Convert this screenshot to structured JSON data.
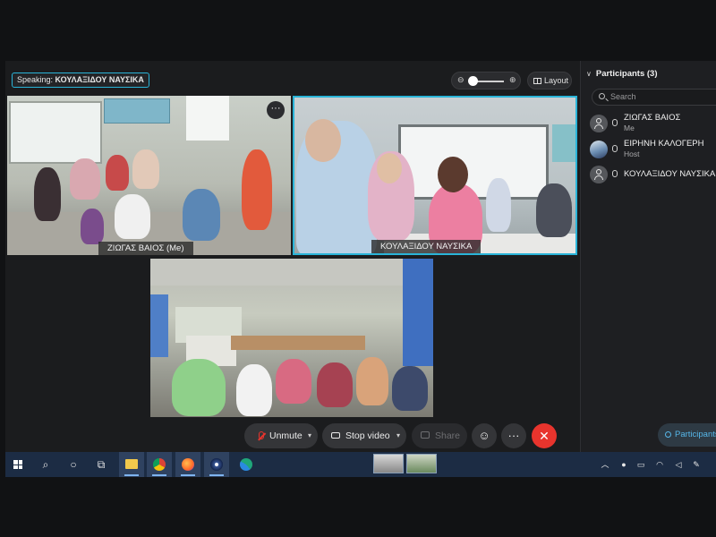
{
  "meeting": {
    "speaking_label": "Speaking:",
    "speaking_name": "ΚΟΥΛΑΞΙΔΟΥ ΝΑΥΣΙΚΑ",
    "layout_label": "Layout",
    "more_label": "···"
  },
  "videos": [
    {
      "label": "ΖΙΩΓΑΣ ΒΑΙΟΣ  (Me)",
      "active": false
    },
    {
      "label": "ΚΟΥΛΑΞΙΔΟΥ ΝΑΥΣΙΚΑ",
      "active": true
    }
  ],
  "toolbar": {
    "unmute_label": "Unmute",
    "stop_video_label": "Stop video",
    "share_label": "Share",
    "more_label": "···",
    "leave_label": "✕",
    "reactions_label": "☺"
  },
  "participants": {
    "title": "Participants (3)",
    "search_placeholder": "Search",
    "button_label": "Participants",
    "list": [
      {
        "name": "ΖΙΩΓΑΣ ΒΑΙΟΣ",
        "role": "Me",
        "avatar": "person-icon"
      },
      {
        "name": "ΕΙΡΗΝΗ ΚΑΛΟΓΕΡΗ",
        "role": "Host",
        "avatar": "photo"
      },
      {
        "name": "ΚΟΥΛΑΞΙΔΟΥ ΝΑΥΣΙΚΑ",
        "role": "",
        "avatar": "person-icon"
      }
    ]
  },
  "taskbar": {
    "apps": [
      "start-icon",
      "search-icon",
      "cortana-icon",
      "task-view-icon",
      "file-explorer-icon",
      "chrome-icon",
      "firefox-icon",
      "webex-icon",
      "edge-icon"
    ],
    "tray": [
      "chevron-up-icon",
      "mic-icon",
      "battery-icon",
      "wifi-icon",
      "volume-icon",
      "pen-icon"
    ]
  },
  "colors": {
    "accent": "#2ab4d8",
    "leave": "#e8342d",
    "taskbar": "#1c2c44",
    "panel": "#1e1f22"
  }
}
